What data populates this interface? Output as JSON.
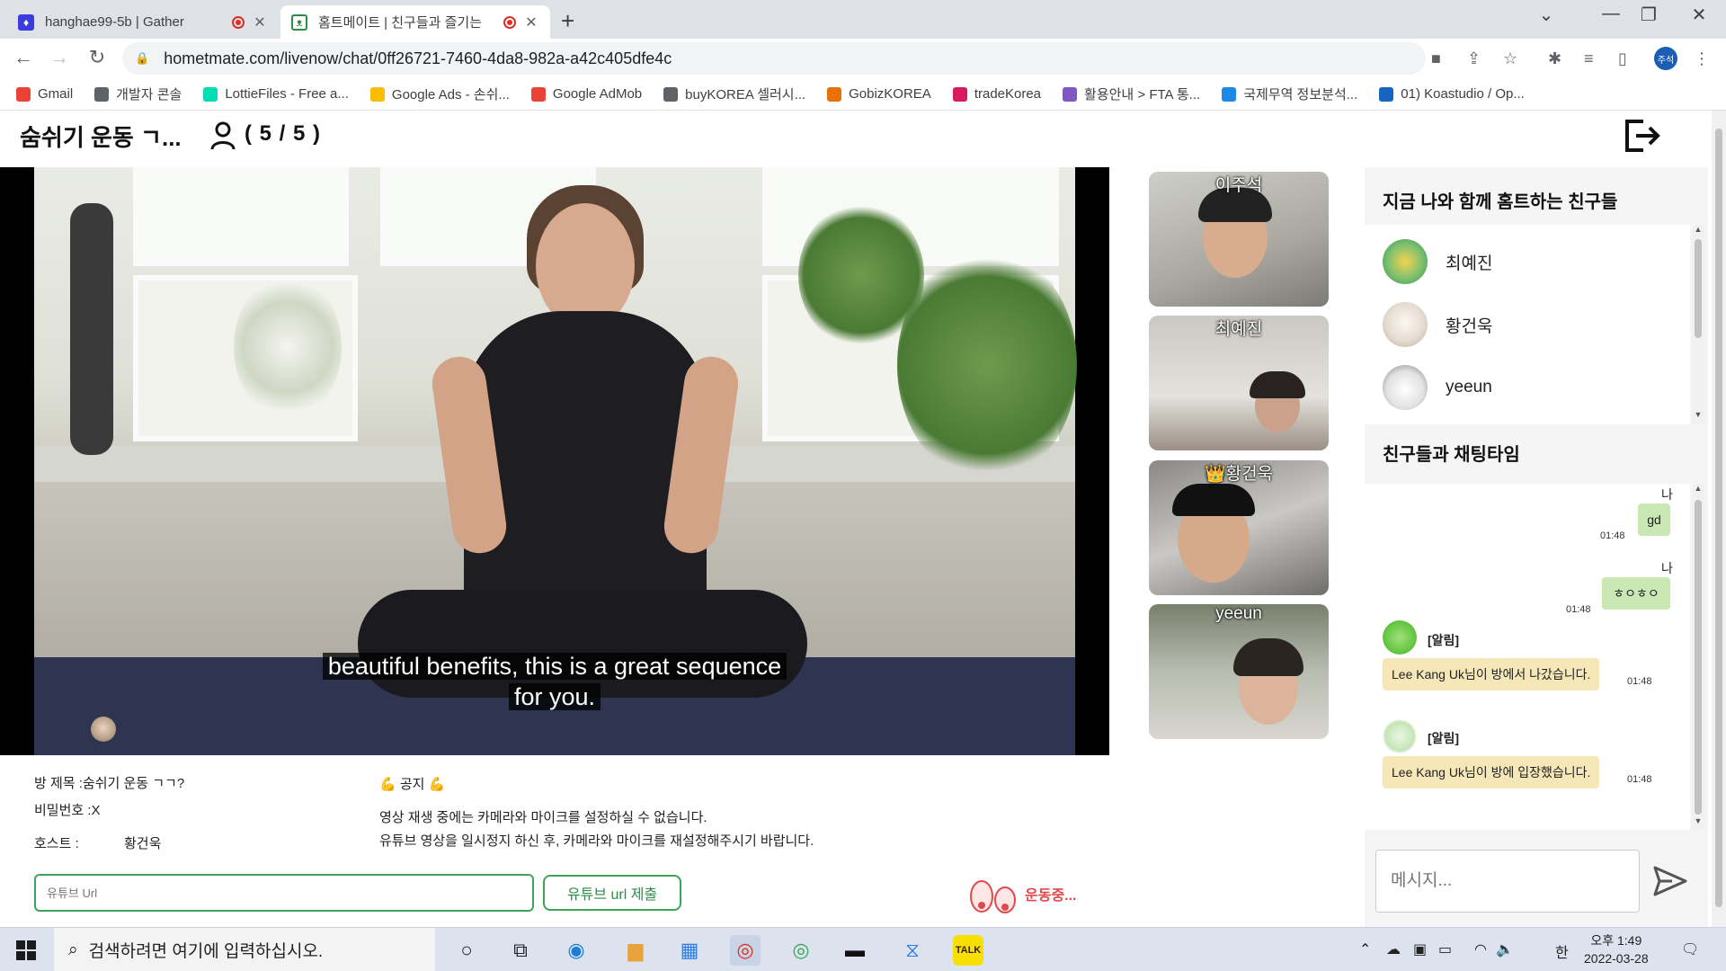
{
  "browser": {
    "tabs": [
      {
        "title": "hanghae99-5b | Gather",
        "active": false,
        "favicon_color": "#3c3cde"
      },
      {
        "title": "홈트메이트 | 친구들과 즐기는",
        "active": true,
        "favicon_color": "#2e8b4a"
      }
    ],
    "url": "hometmate.com/livenow/chat/0ff26721-7460-4da8-982a-a42c405dfe4c",
    "profile_label": "주석",
    "bookmarks": [
      {
        "label": "Gmail",
        "color": "#ea4335"
      },
      {
        "label": "개발자 콘솔",
        "color": "#5f6368"
      },
      {
        "label": "LottieFiles - Free a...",
        "color": "#00ddb3"
      },
      {
        "label": "Google Ads - 손쉬...",
        "color": "#fbbc04"
      },
      {
        "label": "Google AdMob",
        "color": "#ea4335"
      },
      {
        "label": "buyKOREA 셀러시...",
        "color": "#5f6368"
      },
      {
        "label": "GobizKOREA",
        "color": "#e8710a"
      },
      {
        "label": "tradeKorea",
        "color": "#d81b60"
      },
      {
        "label": "활용안내 > FTA 통...",
        "color": "#7e57c2"
      },
      {
        "label": "국제무역 정보분석...",
        "color": "#1e88e5"
      },
      {
        "label": "01) Koastudio / Op...",
        "color": "#1565c0"
      }
    ]
  },
  "header": {
    "room_title": "숨쉬기 운동 ㄱ...",
    "member_count": "( 5 / 5 )"
  },
  "video": {
    "subtitle_line1": "beautiful benefits, this is a great sequence",
    "subtitle_line2": "for you."
  },
  "room_info": {
    "title_line": "방 제목 :숨쉬기 운동 ㄱㄱ?",
    "password_line": "비밀번호 :X",
    "host_label": "호스트 :",
    "host_name": "황건욱",
    "notice_title": "💪 공지 💪",
    "notice_line1": "영상 재생 중에는 카메라와 마이크를 설정하실 수 없습니다.",
    "notice_line2": "유튜브 영상을 일시정지 하신 후, 카메라와 마이크를 재설정해주시기 바랍니다.",
    "url_placeholder": "유튜브 Url",
    "url_button": "유튜브 url 제출",
    "status": "운동중..."
  },
  "participants": [
    {
      "name": "이주석",
      "host": false
    },
    {
      "name": "최예진",
      "host": false
    },
    {
      "name": "👑황건욱",
      "host": true
    },
    {
      "name": "yeeun",
      "host": false
    }
  ],
  "friends_panel": {
    "heading": "지금 나와 함께 홈트하는 친구들",
    "friends": [
      "최예진",
      "황건욱",
      "yeeun"
    ]
  },
  "chat_panel": {
    "heading": "친구들과 채팅타임",
    "messages": [
      {
        "sender": "나",
        "text": "gd",
        "time": "01:48"
      },
      {
        "sender": "나",
        "text": "ㅎㅇㅎㅇ",
        "time": "01:48"
      },
      {
        "sender": "[알림]",
        "text": "Lee Kang Uk님이 방에서 나갔습니다.",
        "time": "01:48"
      },
      {
        "sender": "[알림]",
        "text": "Lee Kang Uk님이 방에 입장했습니다.",
        "time": "01:48"
      }
    ],
    "input_placeholder": "메시지..."
  },
  "taskbar": {
    "search_placeholder": "검색하려면 여기에 입력하십시오.",
    "ampm": "오후 1:49",
    "date": "2022-03-28",
    "ime": "한"
  }
}
